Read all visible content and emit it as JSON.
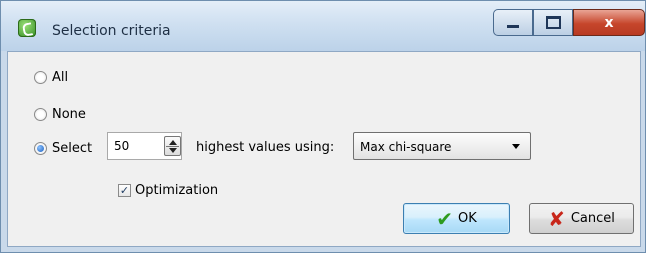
{
  "window": {
    "title": "Selection criteria",
    "controls": {
      "minimize": "min",
      "maximize": "max",
      "close": "x"
    }
  },
  "options": {
    "all_label": "All",
    "none_label": "None",
    "select_label": "Select",
    "selected": "select"
  },
  "select_count": {
    "value": "50"
  },
  "highest_text": "highest values using:",
  "method": {
    "selected": "Max chi-square"
  },
  "optimization": {
    "label": "Optimization",
    "checked": true
  },
  "buttons": {
    "ok": "OK",
    "cancel": "Cancel"
  },
  "colors": {
    "ok_icon": "#2e9b1f",
    "cancel_icon": "#c8261a",
    "titlebar": "#cfe0f1"
  }
}
